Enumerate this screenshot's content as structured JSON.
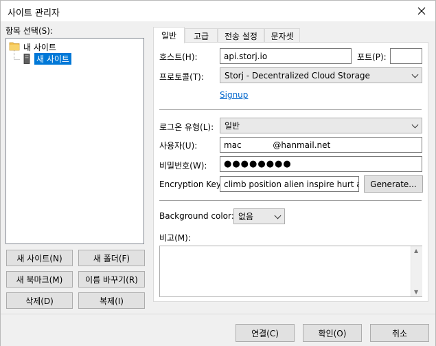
{
  "window": {
    "title": "사이트 관리자"
  },
  "tree": {
    "label": "항목 선택(S):",
    "root": "내 사이트",
    "child": "새 사이트"
  },
  "left_buttons": {
    "new_site": "새 사이트(N)",
    "new_folder": "새 폴더(F)",
    "new_bookmark": "새 북마크(M)",
    "rename": "이름 바꾸기(R)",
    "delete": "삭제(D)",
    "copy": "복제(I)"
  },
  "tabs": [
    "일반",
    "고급",
    "전송 설정",
    "문자셋"
  ],
  "form": {
    "host_label": "호스트(H):",
    "host_value": "api.storj.io",
    "port_label": "포트(P):",
    "port_value": "",
    "protocol_label": "프로토콜(T):",
    "protocol_value": "Storj - Decentralized Cloud Storage",
    "signup_link": "Signup",
    "logon_type_label": "로그온 유형(L):",
    "logon_type_value": "일반",
    "user_label": "사용자(U):",
    "user_value": "mac            @hanmail.net",
    "password_label": "비밀번호(W):",
    "password_value": "●●●●●●●●",
    "enc_key_label": "Encryption Key:",
    "enc_key_value": "climb position alien inspire hurt alert",
    "generate_button": "Generate...",
    "bg_color_label": "Background color:",
    "bg_color_value": "없음",
    "comments_label": "비고(M):",
    "comments_value": ""
  },
  "bottom_buttons": {
    "connect": "연결(C)",
    "ok": "확인(O)",
    "cancel": "취소"
  },
  "colors": {
    "selection": "#0078d7",
    "link": "#0066cc",
    "folder": "#f4c14f"
  }
}
